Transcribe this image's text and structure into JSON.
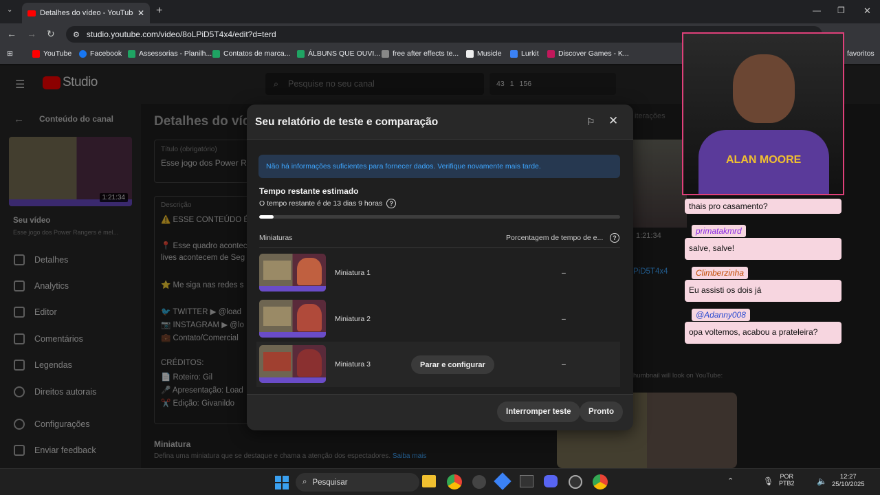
{
  "browser": {
    "tab_title": "Detalhes do vídeo - YouTube Studio",
    "url": "studio.youtube.com/video/8oLPiD5T4x4/edit?d=terd",
    "bookmarks": [
      "YouTube",
      "Facebook",
      "Assessorias - Planilh...",
      "Contatos de marca...",
      "ÁLBUNS QUE OUVI...",
      "free after effects te...",
      "Musicle",
      "Lurkit",
      "Discover Games - K..."
    ],
    "bookmarks_right": "favoritos"
  },
  "studio": {
    "logo": "Studio",
    "search_placeholder": "Pesquise no seu canal",
    "stats": [
      "43",
      "1",
      "156"
    ],
    "channel_content": "Conteúdo do canal",
    "video_duration": "1:21:34",
    "your_video": "Seu vídeo",
    "your_video_sub": "Esse jogo dos Power Rangers é mel...",
    "nav": [
      "Detalhes",
      "Analytics",
      "Editor",
      "Comentários",
      "Legendas",
      "Direitos autorais",
      "Configurações",
      "Enviar feedback"
    ],
    "page_title": "Detalhes do víde",
    "title_label": "Título (obrigatório)",
    "title_value": "Esse jogo dos Power Ra",
    "desc_label": "Descrição",
    "desc_lines": [
      "⚠️ ESSE CONTEÚDO É",
      "📍 Esse quadro acontec",
      "lives acontecem de Seg",
      "⭐ Me siga nas redes s",
      "🐦 TWITTER ▶ @load",
      "📷 INSTAGRAM ▶ @lo",
      "💼 Contato/Comercial",
      "CRÉDITOS:",
      "📄 Roteiro: Gil",
      "🎤 Apresentação: Load",
      "✂️ Edição: Givanildo"
    ],
    "thumb_title": "Miniatura",
    "thumb_desc": "Defina uma miniatura que se destaque e chama a atenção dos espectadores.",
    "thumb_link": "Saiba mais",
    "right_duration": "1:21:34",
    "right_id": "PiD5T4x4",
    "right_note": "humbnail will look on YouTube:",
    "right_tab": "iterações"
  },
  "modal": {
    "title": "Seu relatório de teste e comparação",
    "info": "Não há informações suficientes para fornecer dados. Verifique novamente mais tarde.",
    "time_title": "Tempo restante estimado",
    "time_sub": "O tempo restante é de 13 dias 9 horas",
    "progress": 0.04,
    "col_thumbs": "Miniaturas",
    "col_percent": "Porcentagem de tempo de e...",
    "rows": [
      {
        "label": "Miniatura 1",
        "value": "–"
      },
      {
        "label": "Miniatura 2",
        "value": "–"
      },
      {
        "label": "Miniatura 3",
        "value": "–"
      }
    ],
    "pause_label": "Parar e configurar",
    "stop_label": "Interromper teste",
    "done_label": "Pronto"
  },
  "stream": {
    "chat": [
      {
        "user": "",
        "text": "thais pro casamento?"
      },
      {
        "user": "primatakmrd",
        "text": "salve, salve!"
      },
      {
        "user": "Climberzinha",
        "text": "Eu assisti os dois já"
      },
      {
        "user": "@Adanny008",
        "text": "opa voltemos, acabou a prateleira?"
      }
    ],
    "shirt_text": "ALAN MOORE"
  },
  "taskbar": {
    "search": "Pesquisar",
    "lang": "POR",
    "lang2": "PTB2",
    "time": "12:27",
    "date": "25/10/2025"
  },
  "colors": {
    "accent": "#3ea6ff",
    "chat_bg": "#f7d6e0",
    "yt_red": "#ff0000"
  }
}
